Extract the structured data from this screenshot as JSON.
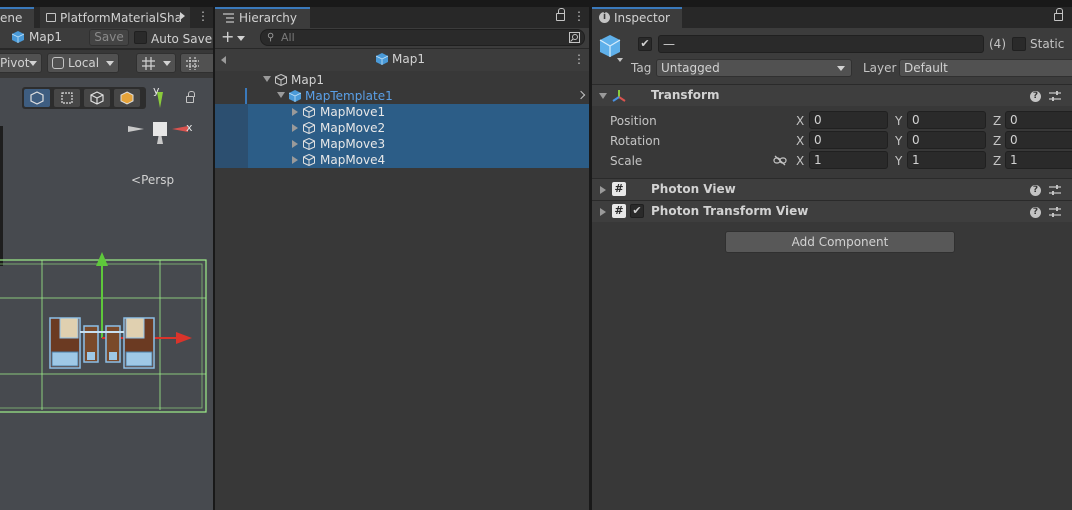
{
  "scene_tab": {
    "label_fragment": "ene"
  },
  "material_tab": {
    "label": "PlatformMaterialSha"
  },
  "hierarchy_tab": {
    "label": "Hierarchy"
  },
  "inspector_tab": {
    "label": "Inspector"
  },
  "prefab_bar": {
    "name": "Map1",
    "save_label": "Save",
    "autosave_label": "Auto Save"
  },
  "scene_tools": {
    "pivot": "Pivot",
    "space": "Local",
    "persp_label": "Persp",
    "axis_y": "y",
    "axis_x": "x"
  },
  "hierarchy": {
    "search_placeholder": "All",
    "header_title": "Map1",
    "rows": [
      {
        "label": "Map1",
        "selected": false
      },
      {
        "label": "MapTemplate1",
        "selected": false,
        "prefab": true
      },
      {
        "label": "MapMove1",
        "selected": true
      },
      {
        "label": "MapMove2",
        "selected": true
      },
      {
        "label": "MapMove3",
        "selected": true
      },
      {
        "label": "MapMove4",
        "selected": true
      }
    ]
  },
  "inspector": {
    "name_value": "—",
    "multi_count": "(4)",
    "static_label": "Static",
    "tag_label": "Tag",
    "tag_value": "Untagged",
    "layer_label": "Layer",
    "layer_value": "Default",
    "transform": {
      "title": "Transform",
      "position_label": "Position",
      "rotation_label": "Rotation",
      "scale_label": "Scale",
      "position": {
        "x": "0",
        "y": "0",
        "z": "0"
      },
      "rotation": {
        "x": "0",
        "y": "0",
        "z": "0"
      },
      "scale": {
        "x": "1",
        "y": "1",
        "z": "1"
      },
      "axis_x": "X",
      "axis_y": "Y",
      "axis_z": "Z"
    },
    "components": [
      {
        "title": "Photon View",
        "script_icon": "#"
      },
      {
        "title": "Photon Transform View",
        "script_icon": "#",
        "checked": "✔"
      }
    ],
    "add_component_label": "Add Component"
  },
  "colors": {
    "selection": "#2c5d87",
    "accent": "#3a79bb",
    "prefab_text": "#5aa0e8"
  }
}
